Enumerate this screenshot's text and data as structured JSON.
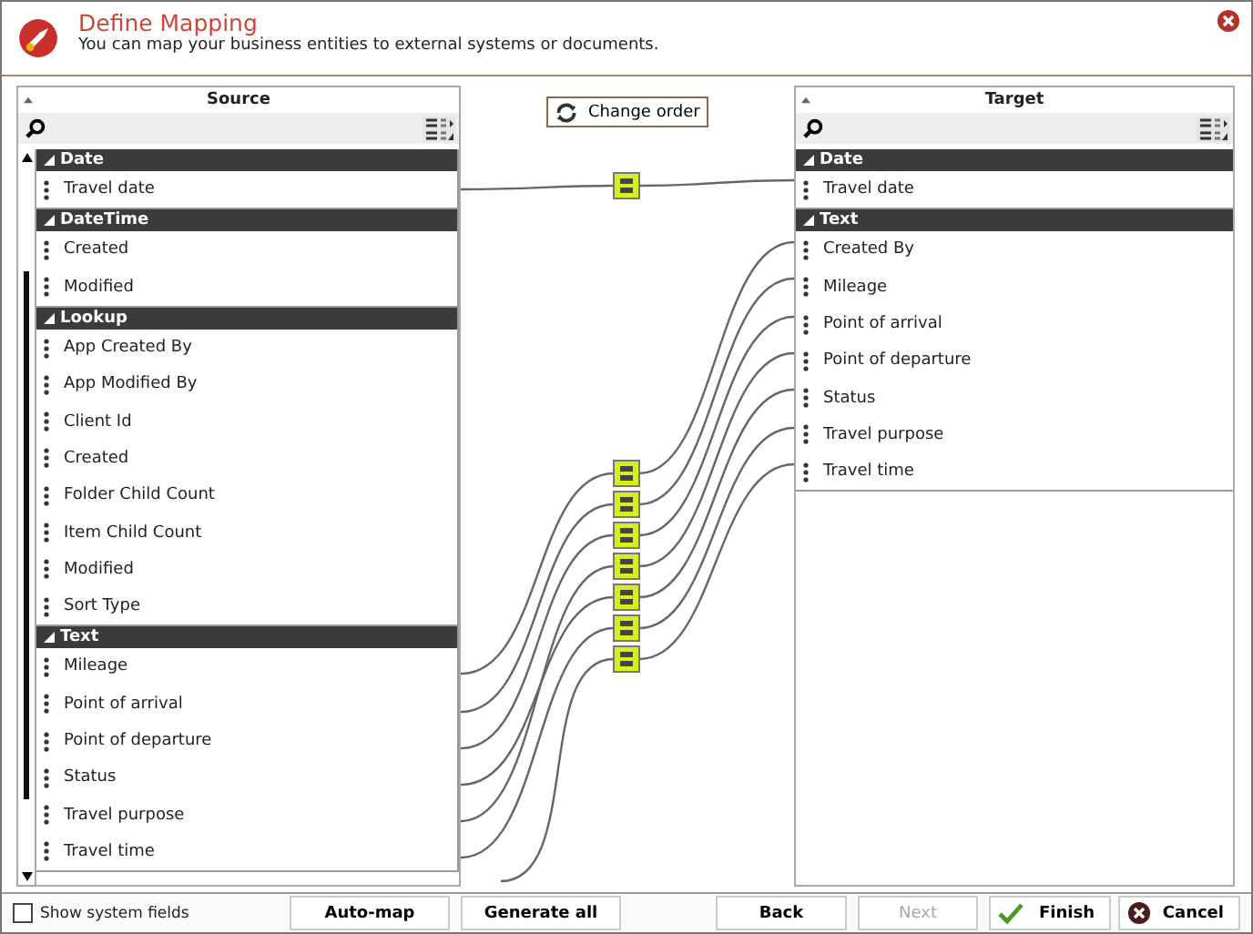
{
  "header": {
    "title": "Define Mapping",
    "subtitle": "You can map your business entities to external systems or documents."
  },
  "change_order": "Change order",
  "source": {
    "title": "Source",
    "groups": [
      {
        "name": "Date",
        "expanded": true,
        "items": [
          "Travel date"
        ]
      },
      {
        "name": "DateTime",
        "expanded": true,
        "items": [
          "Created",
          "Modified"
        ]
      },
      {
        "name": "Lookup",
        "expanded": true,
        "items": [
          "App Created By",
          "App Modified By",
          "Client Id",
          "Created",
          "Folder Child Count",
          "Item Child Count",
          "Modified",
          "Sort Type"
        ]
      },
      {
        "name": "Text",
        "expanded": true,
        "items": [
          "Mileage",
          "Point of arrival",
          "Point of departure",
          "Status",
          "Travel purpose",
          "Travel time"
        ]
      }
    ]
  },
  "target": {
    "title": "Target",
    "groups": [
      {
        "name": "Date",
        "expanded": true,
        "items": [
          "Travel date"
        ]
      },
      {
        "name": "Text",
        "expanded": true,
        "items": [
          "Created By",
          "Mileage",
          "Point of arrival",
          "Point of departure",
          "Status",
          "Travel purpose",
          "Travel time"
        ]
      }
    ]
  },
  "show_system_fields": {
    "label": "Show system fields",
    "checked": false
  },
  "buttons": [
    {
      "label": "Auto-map",
      "kind": "plain",
      "disabled": false
    },
    {
      "label": "Generate all",
      "kind": "plain",
      "disabled": false
    },
    {
      "label": "Back",
      "kind": "plain",
      "disabled": false
    },
    {
      "label": "Next",
      "kind": "plain",
      "disabled": true
    },
    {
      "label": "Finish",
      "kind": "finish",
      "disabled": false
    },
    {
      "label": "Cancel",
      "kind": "cancel",
      "disabled": false
    }
  ]
}
